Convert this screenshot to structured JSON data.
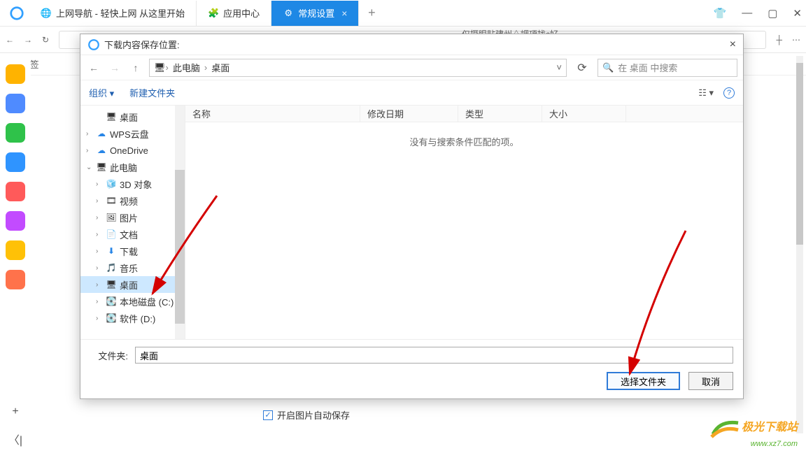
{
  "tabs": [
    {
      "label": "上网导航 - 轻快上网 从这里开始"
    },
    {
      "label": "应用中心"
    },
    {
      "label": "常规设置"
    }
  ],
  "window_controls": {
    "ext": "👕",
    "min": "—",
    "max": "▢",
    "close": "✕"
  },
  "toolbar": {
    "back": "←",
    "fwd": "→",
    "reload": "↻",
    "addtab": "┼",
    "menu": "⋯"
  },
  "bookmark_label": "书签",
  "page_hint": "仅摄眼贴建州△調項找c好",
  "sidebar_apps": [
    {
      "color": "#ffb300"
    },
    {
      "color": "#4f8bff"
    },
    {
      "color": "#2fc24a"
    },
    {
      "color": "#2f94ff"
    },
    {
      "color": "#ff5a5a"
    },
    {
      "color": "#c24bff"
    },
    {
      "color": "#ffc107"
    },
    {
      "color": "#ff724b"
    }
  ],
  "dialog": {
    "title": "下载内容保存位置:",
    "path_segments": [
      "此电脑",
      "桌面"
    ],
    "search_placeholder": "在 桌面 中搜索",
    "toolbar": {
      "organize": "组织",
      "newfolder": "新建文件夹"
    },
    "columns": {
      "name": "名称",
      "modified": "修改日期",
      "type": "类型",
      "size": "大小"
    },
    "empty_msg": "没有与搜索条件匹配的项。",
    "tree": [
      {
        "level": 2,
        "exp": "",
        "icon": "🖥",
        "label": "桌面",
        "sel": false
      },
      {
        "level": 1,
        "exp": "›",
        "icon": "☁",
        "label": "WPS云盘",
        "sel": false,
        "iconColor": "#2785e6"
      },
      {
        "level": 1,
        "exp": "›",
        "icon": "☁",
        "label": "OneDrive",
        "sel": false,
        "iconColor": "#2785e6"
      },
      {
        "level": 1,
        "exp": "⌄",
        "icon": "🖥",
        "label": "此电脑",
        "sel": false
      },
      {
        "level": 2,
        "exp": "›",
        "icon": "🧊",
        "label": "3D 对象",
        "sel": false
      },
      {
        "level": 2,
        "exp": "›",
        "icon": "🎞",
        "label": "视频",
        "sel": false
      },
      {
        "level": 2,
        "exp": "›",
        "icon": "🖼",
        "label": "图片",
        "sel": false
      },
      {
        "level": 2,
        "exp": "›",
        "icon": "📄",
        "label": "文档",
        "sel": false
      },
      {
        "level": 2,
        "exp": "›",
        "icon": "⬇",
        "label": "下载",
        "sel": false,
        "iconColor": "#2785e6"
      },
      {
        "level": 2,
        "exp": "›",
        "icon": "🎵",
        "label": "音乐",
        "sel": false,
        "iconColor": "#2785e6"
      },
      {
        "level": 2,
        "exp": "›",
        "icon": "🖥",
        "label": "桌面",
        "sel": true
      },
      {
        "level": 2,
        "exp": "›",
        "icon": "💽",
        "label": "本地磁盘 (C:)",
        "sel": false
      },
      {
        "level": 2,
        "exp": "›",
        "icon": "💽",
        "label": "软件 (D:)",
        "sel": false
      }
    ],
    "folder_label": "文件夹:",
    "folder_value": "桌面",
    "btn_select": "选择文件夹",
    "btn_cancel": "取消",
    "help": "?"
  },
  "page": {
    "checkbox_label": "开启图片自动保存"
  },
  "watermark": {
    "line1": "极光下载站",
    "line2": "www.xz7.com"
  }
}
